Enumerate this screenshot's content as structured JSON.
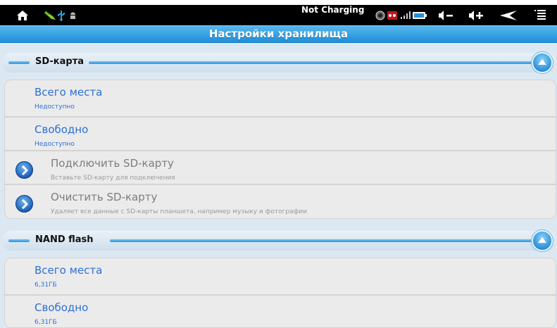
{
  "status_bar": {
    "battery_status": "Not Charging",
    "icons": [
      "home-icon",
      "usb-debug-icon",
      "usb-icon",
      "android-icon",
      "clock-icon",
      "alert-icon",
      "signal-icon",
      "battery-icon",
      "volume-down-icon",
      "volume-up-icon",
      "back-icon",
      "menu-icon"
    ],
    "accent_color": "#2f97dd"
  },
  "header": {
    "title": "Настройки хранилища"
  },
  "sections": [
    {
      "title": "SD-карта",
      "items": [
        {
          "title": "Всего места",
          "summary": "Недоступно"
        },
        {
          "title": "Свободно",
          "summary": "Недоступно"
        },
        {
          "title": "Подключить SD-карту",
          "summary": "Вставьте SD-карту для подключения",
          "enabled": false
        },
        {
          "title": "Очистить SD-карту",
          "summary": "Удаляет все данные с SD-карты планшета, например музыку и фотографии",
          "enabled": false
        }
      ]
    },
    {
      "title": "NAND flash",
      "items": [
        {
          "title": "Всего места",
          "summary": "6,31ГБ"
        },
        {
          "title": "Свободно",
          "summary": "6,31ГБ"
        }
      ]
    }
  ]
}
